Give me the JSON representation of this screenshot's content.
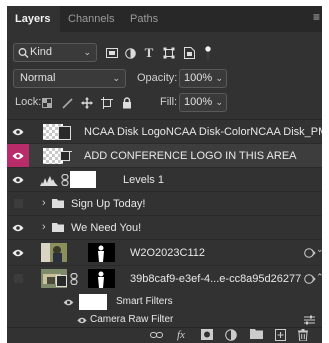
{
  "tabs": [
    "Layers",
    "Channels",
    "Paths"
  ],
  "filter": {
    "kind_label": "Kind"
  },
  "blend": {
    "mode": "Normal",
    "opacity_label": "Opacity:",
    "opacity_value": "100%"
  },
  "lock": {
    "label": "Lock:",
    "fill_label": "Fill:",
    "fill_value": "100%"
  },
  "layers": [
    {
      "name": "NCAA Disk LogoNCAA Disk-ColorNCAA Disk_PMS"
    },
    {
      "name": "ADD CONFERENCE LOGO IN THIS AREA"
    },
    {
      "name": "Levels 1"
    },
    {
      "name": "Sign Up Today!"
    },
    {
      "name": "We Need You!"
    },
    {
      "name": "W2O2023C112"
    },
    {
      "name": "39b8caf9-e3ef-4...e-cc8a95d26277"
    }
  ],
  "smart_filters": {
    "label": "Smart Filters",
    "camera_raw": "Camera Raw Filter"
  },
  "colors": {
    "selection_accent": "#b82c6a",
    "panel_bg": "#323232"
  },
  "bottom_bar": {
    "fx_label": "fx"
  }
}
